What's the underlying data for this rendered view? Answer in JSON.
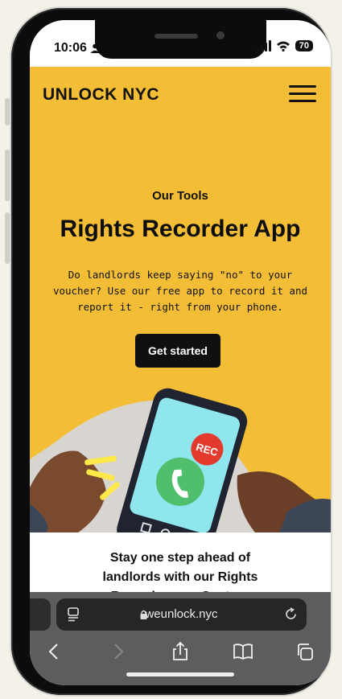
{
  "status": {
    "time": "10:06",
    "battery": "70"
  },
  "header": {
    "brand": "UNLOCK NYC"
  },
  "hero": {
    "eyebrow": "Our Tools",
    "title": "Rights Recorder App",
    "description": "Do landlords keep saying \"no\" to your voucher? Use our free app to record it and report it - right from your phone.",
    "cta_label": "Get started",
    "rec_badge": "REC"
  },
  "section": {
    "lines": [
      "Stay one step ahead of",
      "landlords with our Rights",
      "Recorder app. Capture"
    ]
  },
  "browser": {
    "url": "weunlock.nyc"
  },
  "colors": {
    "accent": "#f3bd35",
    "phone_screen": "#8fe6ec",
    "rec": "#e23b2e",
    "call_green": "#4fbf6b"
  },
  "icons": [
    "person-icon",
    "signal-icon",
    "wifi-icon",
    "battery-icon",
    "menu-icon",
    "reader-icon",
    "lock-icon",
    "reload-icon",
    "back-icon",
    "forward-icon",
    "share-icon",
    "bookmarks-icon",
    "tabs-icon",
    "phone-call-icon"
  ]
}
